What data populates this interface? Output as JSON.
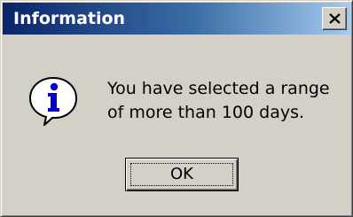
{
  "window": {
    "title": "Information",
    "close_icon": "close-icon"
  },
  "content": {
    "icon": "info-icon",
    "message_lines": [
      "You have selected a range",
      "of more than 100 days."
    ]
  },
  "buttons": {
    "ok_label": "OK"
  },
  "colors": {
    "titlebar_start": "#0a246a",
    "titlebar_end": "#a6caf0",
    "dialog_face": "#d4d0c8",
    "icon_blue": "#0000cc"
  }
}
